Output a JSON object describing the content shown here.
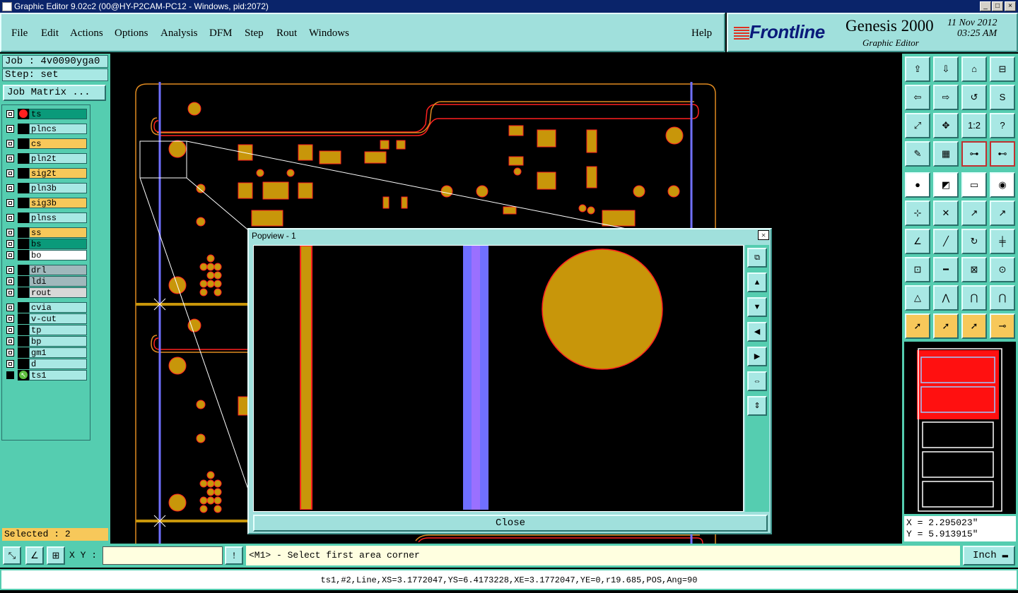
{
  "window": {
    "title": "Graphic Editor 9.02c2 (00@HY-P2CAM-PC12 - Windows, pid:2072)"
  },
  "menu": [
    "File",
    "Edit",
    "Actions",
    "Options",
    "Analysis",
    "DFM",
    "Step",
    "Rout",
    "Windows"
  ],
  "help_label": "Help",
  "brand": {
    "logo": "Frontline",
    "product": "Genesis 2000",
    "subtitle": "Graphic Editor",
    "date": "11 Nov 2012",
    "time": "03:25 AM"
  },
  "job": {
    "job": "Job : 4v0090yga0",
    "step": "Step: set",
    "matrix_label": "Job Matrix ..."
  },
  "layers": [
    {
      "name": "ts",
      "color": "#0a9a7a",
      "active": true
    },
    {
      "name": "plncs",
      "color": "#a8e8e4"
    },
    {
      "name": "cs",
      "color": "#f7c85a"
    },
    {
      "name": "pln2t",
      "color": "#a8e8e4"
    },
    {
      "name": "sig2t",
      "color": "#f7c85a"
    },
    {
      "name": "pln3b",
      "color": "#a8e8e4"
    },
    {
      "name": "sig3b",
      "color": "#f7c85a"
    },
    {
      "name": "plnss",
      "color": "#a8e8e4"
    },
    {
      "name": "ss",
      "color": "#f7c85a"
    },
    {
      "name": "bs",
      "color": "#0a9a7a"
    },
    {
      "name": "bo",
      "color": "#ffffff"
    },
    {
      "name": "drl",
      "color": "#a0b8bc"
    },
    {
      "name": "ldi",
      "color": "#a0b8bc"
    },
    {
      "name": "rout",
      "color": "#d8d8d8"
    },
    {
      "name": "cvia",
      "color": "#a8e8e4"
    },
    {
      "name": "v-cut",
      "color": "#a8e8e4"
    },
    {
      "name": "tp",
      "color": "#a8e8e4"
    },
    {
      "name": "bp",
      "color": "#a8e8e4"
    },
    {
      "name": "gm1",
      "color": "#a8e8e4"
    },
    {
      "name": "d",
      "color": "#a8e8e4"
    },
    {
      "name": "ts1",
      "color": "#a8e8e4",
      "work": true
    }
  ],
  "selected": "Selected : 2",
  "popview": {
    "title": "Popview - 1",
    "close_label": "Close"
  },
  "coords": {
    "x": "X = 2.295023\"",
    "y": "Y = 5.913915\""
  },
  "cmd": {
    "xy_label": "X Y :",
    "xy_value": "",
    "message": "<M1> - Select first area corner",
    "units": "Inch"
  },
  "status_text": "ts1,#2,Line,XS=3.1772047,YS=6.4173228,XE=3.1772047,YE=0,r19.685,POS,Ang=90",
  "colors": {
    "panel": "#55cdb0",
    "light": "#a8e8e4",
    "pad": "#c8960a",
    "outline": "#ff2020",
    "rout": "#e08a20",
    "vline": "#7070ff"
  },
  "icons": {
    "toolbar": [
      "zoom-home-icon",
      "pan-icon",
      "home-icon",
      "split-icon",
      "pan-left-icon",
      "pan-right-icon",
      "rotate-icon",
      "snake-icon",
      "fit-icon",
      "center-icon",
      "scale-icon",
      "query-icon",
      "measure-icon",
      "grid-icon",
      "connect-icon",
      "net-icon",
      "select-pad-icon",
      "draw-icon",
      "ruler-icon",
      "circle-icon",
      "node-icon",
      "cross-icon",
      "arc-icon",
      "split-arc-icon",
      "angle-icon",
      "slash-icon",
      "curve-icon",
      "step-icon",
      "pad-add-icon",
      "line-icon",
      "dim-icon",
      "shape-icon",
      "tri-icon",
      "triangle-icon",
      "arch-icon",
      "arch2-icon",
      "arrow-icon",
      "arrow-box-icon",
      "arrow-circle-icon",
      "path-icon"
    ]
  }
}
